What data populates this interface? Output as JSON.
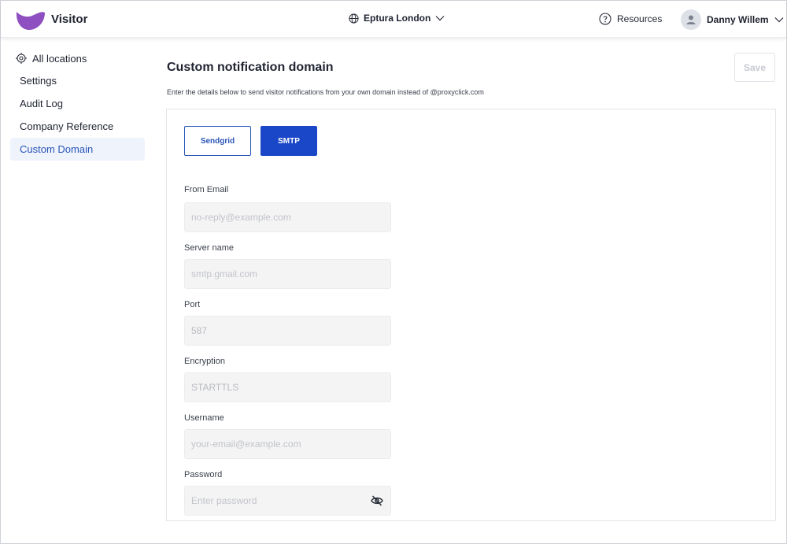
{
  "header": {
    "brand": "Visitor",
    "location": "Eptura London",
    "resources": "Resources",
    "user": "Danny Willem"
  },
  "sidebar": {
    "top": "All locations",
    "items": [
      {
        "label": "Settings"
      },
      {
        "label": "Audit Log"
      },
      {
        "label": "Company Reference"
      },
      {
        "label": "Custom Domain",
        "active": true
      }
    ]
  },
  "main": {
    "title": "Custom notification domain",
    "subtitle": "Enter the details below to send visitor notifications from your own domain instead of @proxyclick.com",
    "save_label": "Save",
    "tabs": [
      {
        "label": "Sendgrid",
        "selected": false
      },
      {
        "label": "SMTP",
        "selected": true
      }
    ],
    "fields": {
      "from_email": {
        "label": "From Email",
        "placeholder": "no-reply@example.com",
        "value": ""
      },
      "server_name": {
        "label": "Server name",
        "placeholder": "smtp.gmail.com",
        "value": ""
      },
      "port": {
        "label": "Port",
        "placeholder": "",
        "value": "587"
      },
      "encryption": {
        "label": "Encryption",
        "placeholder": "",
        "value": "STARTTLS"
      },
      "username": {
        "label": "Username",
        "placeholder": "your-email@example.com",
        "value": ""
      },
      "password": {
        "label": "Password",
        "placeholder": "Enter password",
        "value": ""
      }
    }
  },
  "colors": {
    "brand_purple": "#8e4fc0",
    "accent_blue": "#1a47c7",
    "active_bg": "#eef3fc"
  },
  "icons": [
    "visitor-logo",
    "globe-icon",
    "chevron-down-icon",
    "help-circle-icon",
    "user-avatar-icon",
    "target-icon",
    "eye-off-icon"
  ]
}
